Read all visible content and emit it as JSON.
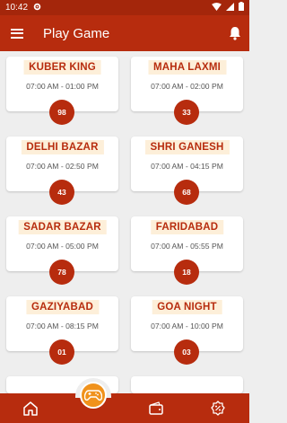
{
  "status_bar": {
    "time": "10:42"
  },
  "header": {
    "title": "Play Game"
  },
  "games": [
    {
      "name": "KUBER KING",
      "time": "07:00 AM - 01:00 PM",
      "result": "98"
    },
    {
      "name": "MAHA LAXMI",
      "time": "07:00 AM - 02:00 PM",
      "result": "33"
    },
    {
      "name": "DELHI BAZAR",
      "time": "07:00 AM - 02:50 PM",
      "result": "43"
    },
    {
      "name": "SHRI GANESH",
      "time": "07:00 AM - 04:15 PM",
      "result": "68"
    },
    {
      "name": "SADAR BAZAR",
      "time": "07:00 AM - 05:00 PM",
      "result": "78"
    },
    {
      "name": "FARIDABAD",
      "time": "07:00 AM - 05:55 PM",
      "result": "18"
    },
    {
      "name": "GAZIYABAD",
      "time": "07:00 AM - 08:15 PM",
      "result": "01"
    },
    {
      "name": "GOA NIGHT",
      "time": "07:00 AM - 10:00 PM",
      "result": "03"
    }
  ],
  "bottom_nav": {
    "items": [
      {
        "icon": "home-icon"
      },
      {
        "icon": "gamepad-icon"
      },
      {
        "icon": "wallet-icon"
      },
      {
        "icon": "discount-icon"
      }
    ]
  },
  "colors": {
    "primary": "#b72c0e",
    "accent": "#f0921c",
    "title_bg": "#fdefd9",
    "background": "#eeeeee"
  }
}
